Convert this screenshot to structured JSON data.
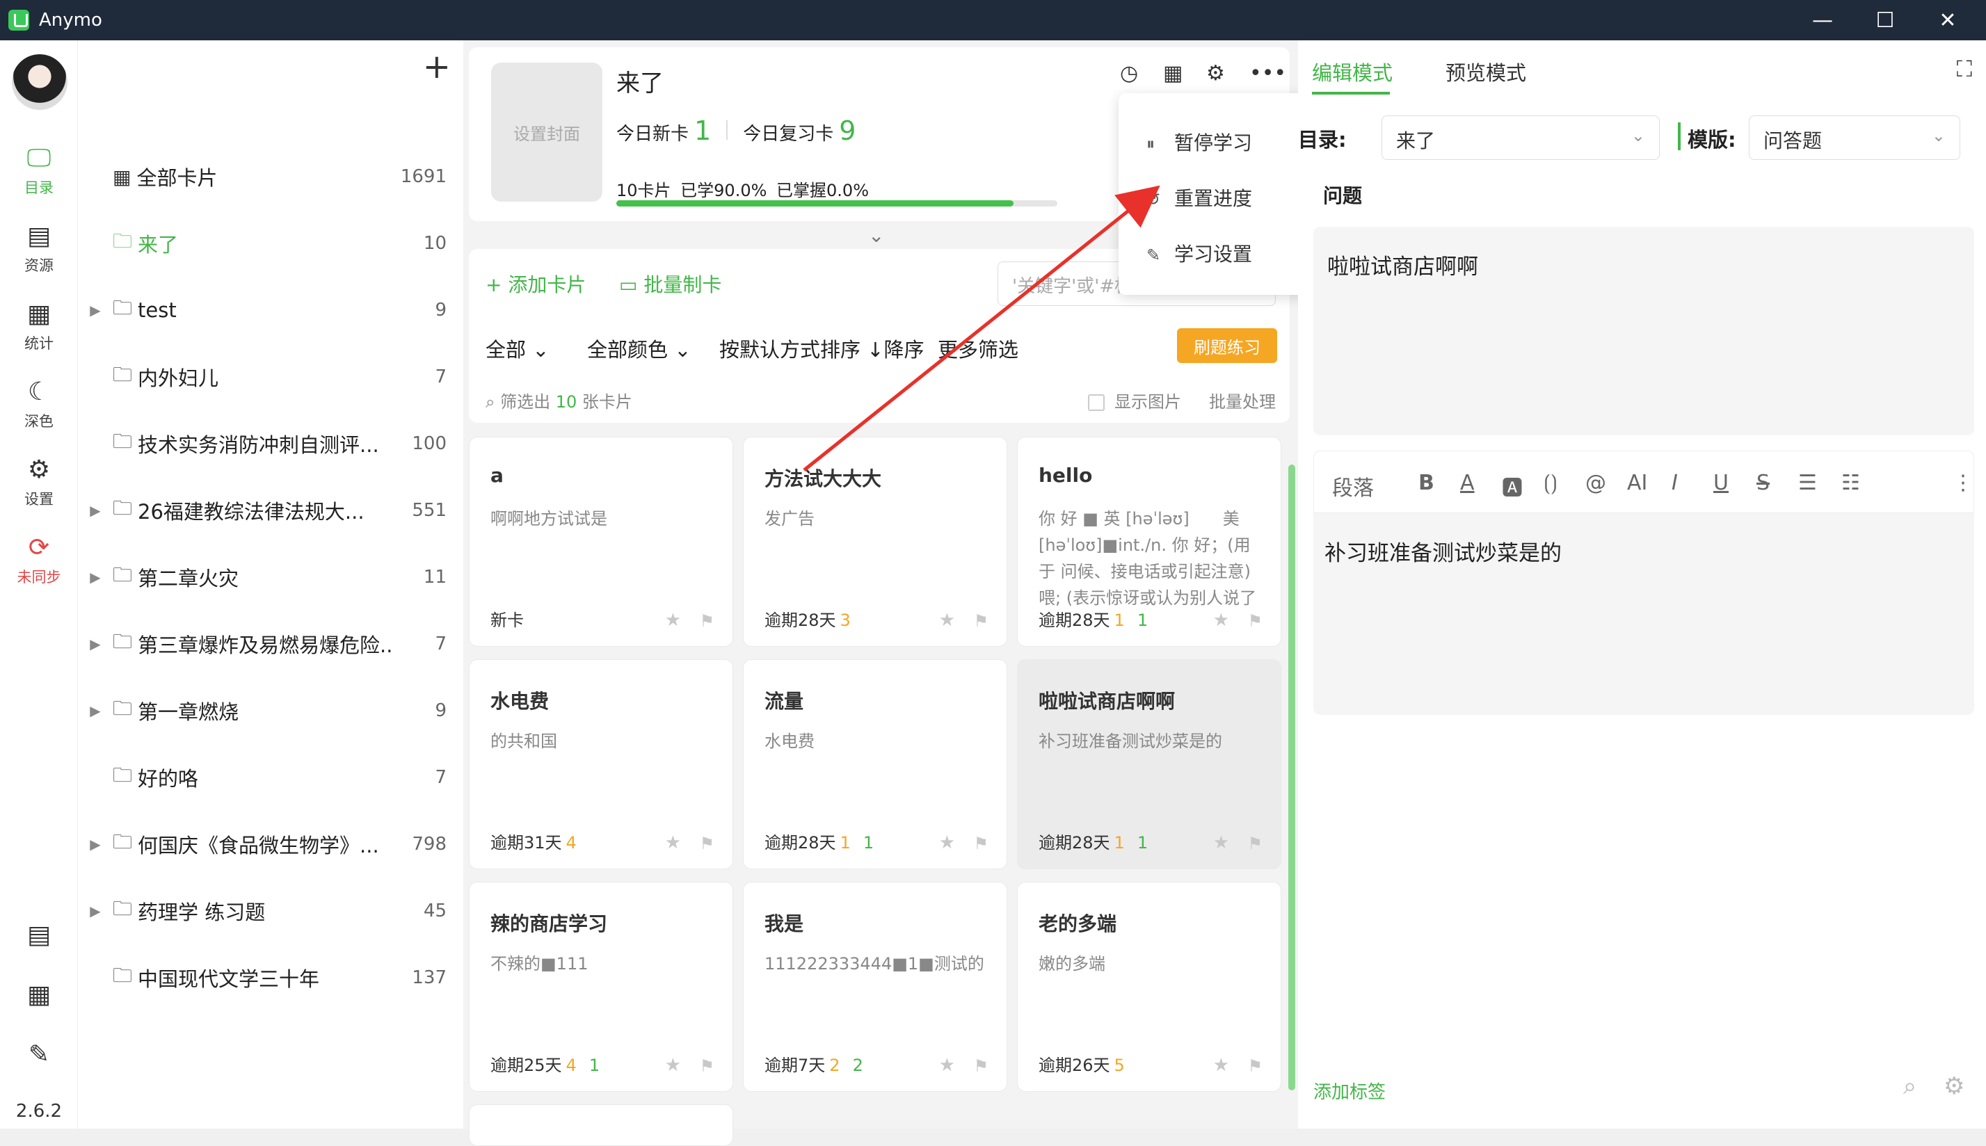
{
  "app": {
    "title": "Anymo",
    "version": "2.6.2"
  },
  "window_controls": {
    "minimize": "—",
    "maximize": "☐",
    "close": "✕"
  },
  "nav": [
    {
      "label": "目录",
      "icon": "monitor-icon",
      "glyph": "🖵"
    },
    {
      "label": "资源",
      "icon": "resource-icon",
      "glyph": "▤"
    },
    {
      "label": "统计",
      "icon": "stats-icon",
      "glyph": "▦"
    },
    {
      "label": "深色",
      "icon": "moon-icon",
      "glyph": "☾"
    },
    {
      "label": "设置",
      "icon": "gear-icon",
      "glyph": "⚙"
    },
    {
      "label": "未同步",
      "icon": "sync-icon",
      "glyph": "⟳"
    }
  ],
  "nav_bottom": [
    {
      "icon": "notebook-icon",
      "glyph": "▤"
    },
    {
      "icon": "grid-icon",
      "glyph": "▦"
    },
    {
      "icon": "pen-icon",
      "glyph": "✎"
    }
  ],
  "tree": {
    "add": "+",
    "items": [
      {
        "label": "全部卡片",
        "count": "1691"
      },
      {
        "label": "来了",
        "count": "10"
      },
      {
        "label": "test",
        "count": "9"
      },
      {
        "label": "内外妇儿",
        "count": "7"
      },
      {
        "label": "技术实务消防冲刺自测评...",
        "count": "100"
      },
      {
        "label": "26福建教综法律法规大...",
        "count": "551"
      },
      {
        "label": "第二章火灾",
        "count": "11"
      },
      {
        "label": "第三章爆炸及易燃易爆危险...",
        "count": "7"
      },
      {
        "label": "第一章燃烧",
        "count": "9"
      },
      {
        "label": "好的咯",
        "count": "7"
      },
      {
        "label": "何国庆《食品微生物学》...",
        "count": "798"
      },
      {
        "label": "药理学 练习题",
        "count": "45"
      },
      {
        "label": "中国现代文学三十年",
        "count": "137"
      }
    ]
  },
  "deck": {
    "cover": "设置封面",
    "title": "来了",
    "today_new_label": "今日新卡",
    "today_new": "1",
    "today_review_label": "今日复习卡",
    "today_review": "9",
    "progress_text": "10卡片  已学90.0%  已掌握0.0%",
    "learned_fraction": 0.9
  },
  "menu": {
    "items": [
      {
        "label": "暂停学习",
        "glyph": "⏸"
      },
      {
        "label": "重置进度",
        "glyph": "↺"
      },
      {
        "label": "学习设置",
        "glyph": "✎"
      }
    ]
  },
  "toolbar": {
    "add_card": "+ 添加卡片",
    "batch": "▭ 批量制卡",
    "search_placeholder": "'关键字'或'#标",
    "filter_all": "全部",
    "filter_color": "全部颜色",
    "sort": "按默认方式排序 ↓降序",
    "more_filter": "更多筛选",
    "practice": "刷题练习",
    "filtered_pre": "筛选出",
    "filtered_count": "10",
    "filtered_post": "张卡片",
    "show_image": "显示图片",
    "batch_process": "批量处理"
  },
  "cards": [
    {
      "title": "a",
      "body": "啊啊地方试试是",
      "status": "新卡",
      "o": "",
      "g": ""
    },
    {
      "title": "方法试大大大",
      "body": "发广告",
      "status": "逾期28天",
      "o": "3",
      "g": ""
    },
    {
      "title": "hello",
      "body": "你 好 ■ 英 [həˈləʊ]　　美 [həˈloʊ]■int./n. 你 好；(用 于 问候、接电话或引起注意)喂; (表示惊讶或认为别人说了蠢话...",
      "status": "逾期28天",
      "o": "1",
      "g": "1"
    },
    {
      "title": "水电费",
      "body": "的共和国",
      "status": "逾期31天",
      "o": "4",
      "g": ""
    },
    {
      "title": "流量",
      "body": "水电费",
      "status": "逾期28天",
      "o": "1",
      "g": "1"
    },
    {
      "title": "啦啦试商店啊啊",
      "body": "补习班准备测试炒菜是的",
      "status": "逾期28天",
      "o": "1",
      "g": "1"
    },
    {
      "title": "辣的商店学习",
      "body": "不辣的■111",
      "status": "逾期25天",
      "o": "4",
      "g": "1"
    },
    {
      "title": "我是",
      "body": "111222333444■1■测试的",
      "status": "逾期7天",
      "o": "2",
      "g": "2"
    },
    {
      "title": "老的多端",
      "body": "嫩的多端",
      "status": "逾期26天",
      "o": "5",
      "g": ""
    }
  ],
  "editor": {
    "tab_edit": "编辑模式",
    "tab_preview": "预览模式",
    "dir_label": "目录:",
    "dir_value": "来了",
    "template_label": "模版:",
    "template_value": "问答题",
    "question_label": "问题",
    "question_text": "啦啦试商店啊啊",
    "paragraph": "段落",
    "answer_text": "补习班准备测试炒菜是的",
    "add_tag": "添加标签"
  },
  "colors": {
    "accent": "#43b649",
    "warn": "#e64545",
    "orange": "#f5a623",
    "titlebar": "#1f2a3a",
    "arrow": "#e8312a"
  }
}
